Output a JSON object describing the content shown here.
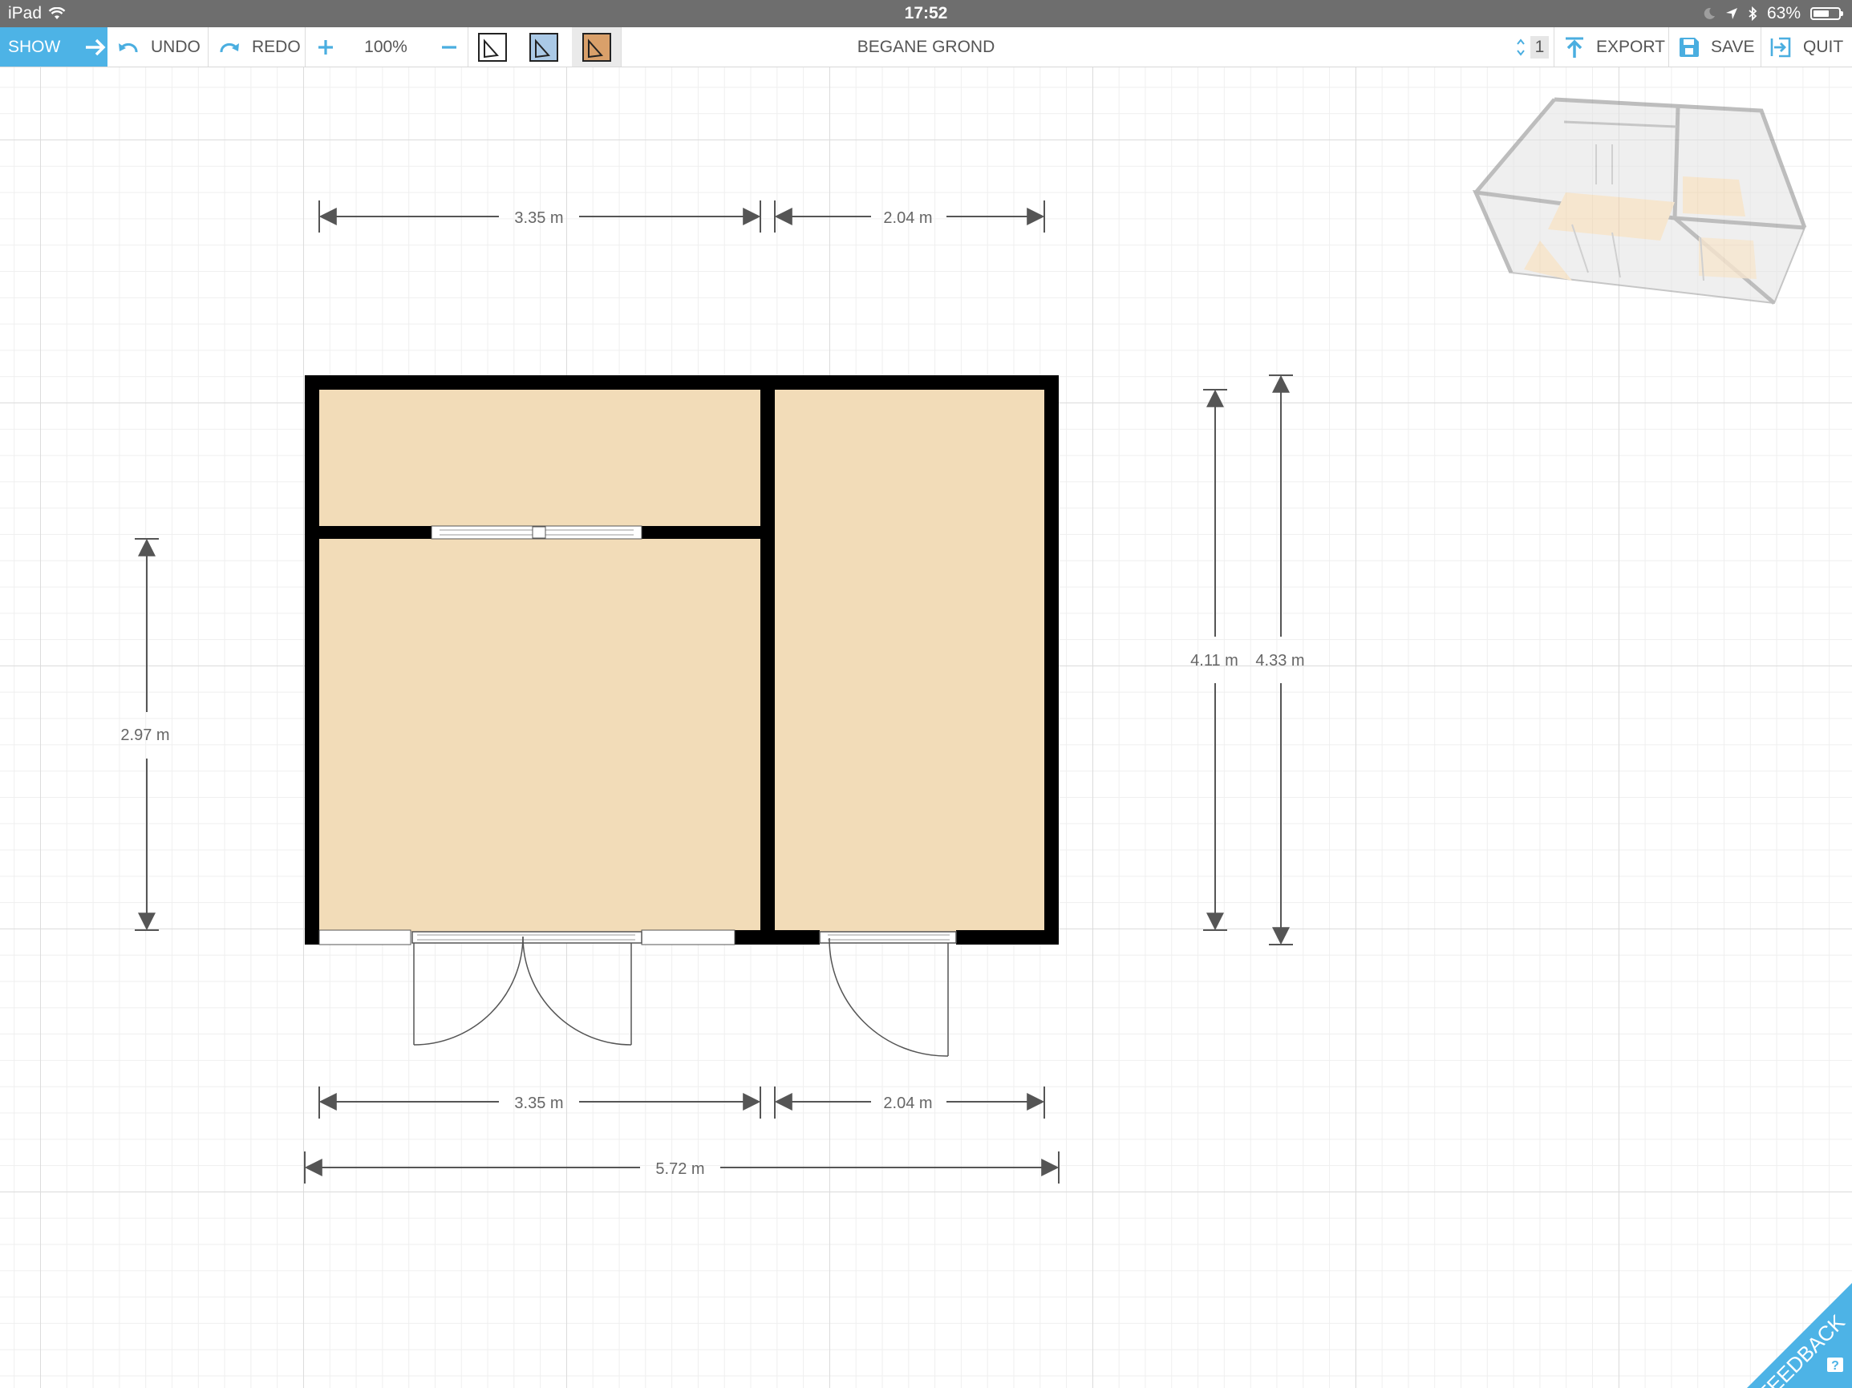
{
  "status_bar": {
    "device": "iPad",
    "time": "17:52",
    "battery": "63%",
    "battery_level": 0.63
  },
  "toolbar": {
    "show_label": "SHOW",
    "undo_label": "UNDO",
    "redo_label": "REDO",
    "zoom": "100%",
    "level_title": "BEGANE GROND",
    "level_number": "1",
    "export_label": "EXPORT",
    "save_label": "SAVE",
    "quit_label": "QUIT"
  },
  "dimensions": {
    "top_left_width": "3.35 m",
    "top_right_width": "2.04 m",
    "left_height": "2.97 m",
    "inner_height": "4.11 m",
    "outer_height": "4.33 m",
    "bottom_left_width": "3.35 m",
    "bottom_right_width": "2.04 m",
    "total_width": "5.72 m"
  },
  "colors": {
    "accent": "#4db3e6",
    "floor": "#f2dcb8",
    "wall": "#000000"
  },
  "feedback_label": "FEEDBACK",
  "help_label": "?"
}
